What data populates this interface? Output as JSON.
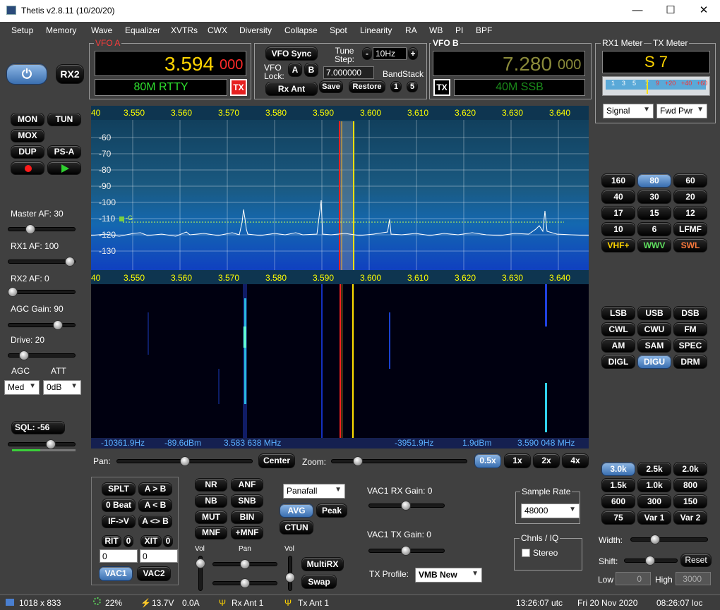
{
  "window": {
    "title": "Thetis v2.8.11 (10/20/20)",
    "minimize": "—",
    "maximize": "☐",
    "close": "✕"
  },
  "menu": [
    "Setup",
    "Memory",
    "Wave",
    "Equalizer",
    "XVTRs",
    "CWX",
    "Diversity",
    "Collapse",
    "Spot",
    "Linearity",
    "RA",
    "WB",
    "PI",
    "BPF"
  ],
  "vfoa": {
    "legend": "VFO A",
    "freq": "3.594",
    "freq_sub": "000",
    "mode": "80M RTTY",
    "tx": "TX"
  },
  "vfo_center": {
    "sync": "VFO Sync",
    "lock": "VFO\nLock:",
    "a": "A",
    "b": "B",
    "rxant": "Rx Ant",
    "tune_step_label": "Tune\nStep:",
    "minus": "-",
    "plus": "+",
    "step": "10Hz",
    "freq_input": "7.000000",
    "bandstack": "BandStack",
    "save": "Save",
    "restore": "Restore",
    "bs1": "1",
    "bs5": "5"
  },
  "vfob": {
    "legend": "VFO B",
    "freq": "7.280",
    "freq_sub": "000",
    "mode": "40M SSB",
    "tx": "TX"
  },
  "meter": {
    "rx1_legend": "RX1 Meter",
    "tx_legend": "TX Meter",
    "reading": "S 7",
    "scale": [
      "1",
      "3",
      "5",
      "7",
      "9",
      "+20",
      "+40",
      "+60"
    ],
    "rx_select": "Signal",
    "tx_select": "Fwd Pwr"
  },
  "left": {
    "power": "⏻",
    "rx2": "RX2",
    "mon": "MON",
    "tun": "TUN",
    "mox": "MOX",
    "dup": "DUP",
    "psa": "PS-A",
    "master_af": "Master AF:  30",
    "rx1_af": "RX1 AF:  100",
    "rx2_af": "RX2 AF:  0",
    "agc_gain": "AGC Gain:  90",
    "drive": "Drive:  20",
    "agc_label": "AGC",
    "att_label": "ATT",
    "agc_value": "Med",
    "att_value": "0dB",
    "sql": "SQL:  -56",
    "levels": {
      "master_af": 0.3,
      "rx1_af": 1.0,
      "rx2_af": 0.0,
      "agc_gain": 0.75,
      "drive": 0.2,
      "sql": 0.6
    }
  },
  "panadapter": {
    "freq_ticks": [
      "40",
      "3.550",
      "3.560",
      "3.570",
      "3.580",
      "3.590",
      "3.600",
      "3.610",
      "3.620",
      "3.630",
      "3.640"
    ],
    "db_ticks": [
      "-60",
      "-70",
      "-80",
      "-90",
      "-100",
      "-110",
      "-120",
      "-130"
    ],
    "marker": "-G",
    "info": [
      "-10361.9Hz",
      "-89.6dBm",
      "3.583 638 MHz",
      "-3951.9Hz",
      "1.9dBm",
      "3.590 048 MHz"
    ]
  },
  "pan_controls": {
    "pan": "Pan:",
    "center": "Center",
    "zoom": "Zoom:",
    "z05": "0.5x",
    "z1": "1x",
    "z2": "2x",
    "z4": "4x"
  },
  "bands": [
    "160",
    "80",
    "60",
    "40",
    "30",
    "20",
    "17",
    "15",
    "12",
    "10",
    "6",
    "LFMF",
    "VHF+",
    "WWV",
    "SWL"
  ],
  "band_selected": "80",
  "band_colors": {
    "VHF+": "#ffd400",
    "WWV": "#5fe05f",
    "SWL": "#ff7a3c"
  },
  "modes": [
    "LSB",
    "USB",
    "DSB",
    "CWL",
    "CWU",
    "FM",
    "AM",
    "SAM",
    "SPEC",
    "DIGL",
    "DIGU",
    "DRM"
  ],
  "mode_selected": "DIGU",
  "filters": [
    "3.0k",
    "2.5k",
    "2.0k",
    "1.5k",
    "1.0k",
    "800",
    "600",
    "300",
    "150",
    "75",
    "Var 1",
    "Var 2"
  ],
  "filter_selected": "3.0k",
  "filter_ctrl": {
    "width": "Width:",
    "shift": "Shift:",
    "reset": "Reset",
    "low": "Low",
    "low_val": "0",
    "high": "High",
    "high_val": "3000"
  },
  "bottom": {
    "splt": "SPLT",
    "atob": "A > B",
    "zerobeat": "0 Beat",
    "altb": "A < B",
    "ifv": "IF->V",
    "aswap": "A <> B",
    "rit": "RIT",
    "rit_val": "0",
    "xit": "XIT",
    "xit_val": "0",
    "rit_in": "0",
    "xit_in": "0",
    "vac1": "VAC1",
    "vac2": "VAC2",
    "nr": "NR",
    "anf": "ANF",
    "nb": "NB",
    "snb": "SNB",
    "mut": "MUT",
    "bin": "BIN",
    "mnf": "MNF",
    "pmnf": "+MNF",
    "vol": "Vol",
    "pan": "Pan",
    "vol2": "Vol",
    "display": "Panafall",
    "avg": "AVG",
    "peak": "Peak",
    "ctun": "CTUN",
    "multirx": "MultiRX",
    "swap": "Swap",
    "vac1_rx": "VAC1  RX Gain:  0",
    "vac1_tx": "VAC1  TX Gain:  0",
    "tx_profile_label": "TX Profile:",
    "tx_profile": "VMB New",
    "sample_rate_legend": "Sample Rate",
    "sample_rate": "48000",
    "chnls_legend": "Chnls / IQ",
    "stereo": "Stereo"
  },
  "status": {
    "size": "1018 x 833",
    "cpu": "22%",
    "volt": "13.7V",
    "amp": "0.0A",
    "rxant": "Rx Ant  1",
    "txant": "Tx Ant  1",
    "utc": "13:26:07 utc",
    "date": "Fri 20 Nov 2020",
    "loc": "08:26:07 loc"
  }
}
